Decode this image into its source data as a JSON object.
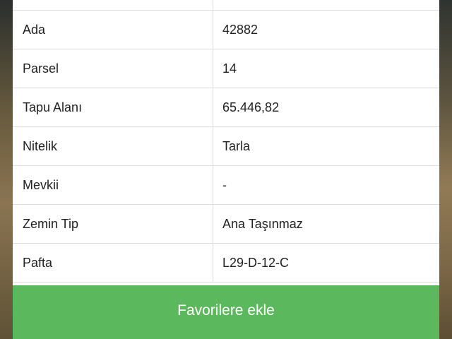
{
  "details": {
    "rows": [
      {
        "label": "",
        "value": ""
      },
      {
        "label": "Ada",
        "value": "42882"
      },
      {
        "label": "Parsel",
        "value": "14"
      },
      {
        "label": "Tapu Alanı",
        "value": "65.446,82"
      },
      {
        "label": "Nitelik",
        "value": "Tarla"
      },
      {
        "label": "Mevkii",
        "value": "-"
      },
      {
        "label": "Zemin Tip",
        "value": "Ana Taşınmaz"
      },
      {
        "label": "Pafta",
        "value": "L29-D-12-C"
      }
    ]
  },
  "actions": {
    "favorite_label": "Favorilere ekle"
  },
  "colors": {
    "button_green": "#5cb85c",
    "border": "#dcdcdc",
    "text": "#222222"
  }
}
